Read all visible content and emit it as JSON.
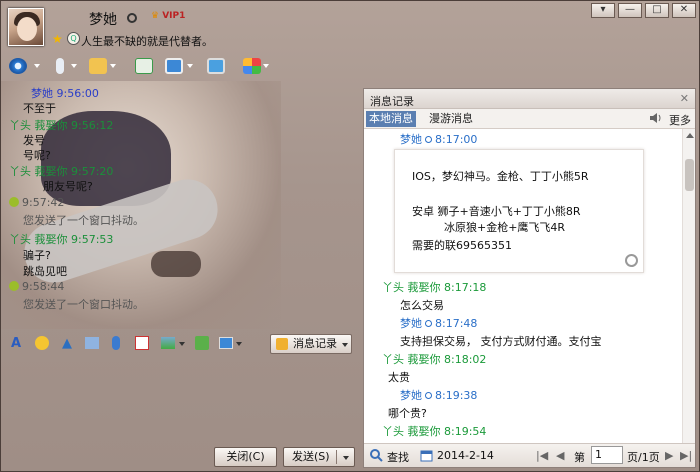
{
  "header": {
    "nickname": "梦她",
    "vip": "VIP1",
    "signature": "人生最不缺的就是代替者。"
  },
  "titlebar": {
    "menu": "▾",
    "minimize": "—",
    "maximize": "□",
    "close": "✕"
  },
  "chat": {
    "messages": [
      {
        "text": "梦她   9:56:00",
        "kind": "from-me"
      },
      {
        "text": "不至于",
        "kind": "plain"
      },
      {
        "text": "丫头   莪娶你   9:56:12",
        "kind": "from-other"
      },
      {
        "text": "发号",
        "kind": "plain"
      },
      {
        "text": "号呢?",
        "kind": "plain"
      },
      {
        "text": "丫头   莪娶你   9:57:20",
        "kind": "from-other"
      },
      {
        "text": "朋友号呢?",
        "kind": "plain"
      },
      {
        "text": "9:57:42",
        "kind": "sys"
      },
      {
        "text": "您发送了一个窗口抖动。",
        "kind": "sys"
      },
      {
        "text": "丫头   莪娶你   9:57:53",
        "kind": "from-other"
      },
      {
        "text": "骗子?",
        "kind": "plain"
      },
      {
        "text": "跳岛见吧",
        "kind": "plain"
      },
      {
        "text": "9:58:44",
        "kind": "sys"
      },
      {
        "text": "您发送了一个窗口抖动。",
        "kind": "sys"
      }
    ]
  },
  "format_bar": {
    "history_label": "消息记录"
  },
  "buttons": {
    "close": "关闭(C)",
    "send": "发送(S)"
  },
  "history": {
    "title": "消息记录",
    "tab_local": "本地消息",
    "tab_roam": "漫游消息",
    "more": "更多",
    "first_sender": "梦她",
    "first_time": "8:17:00",
    "image_lines": [
      "IOS，梦幻神马。金枪、丁丁小熊5R",
      "安卓  狮子+音速小飞+丁丁小熊8R",
      "冰原狼+金枪+鹰飞飞4R",
      "需要的联69565351"
    ],
    "entries": [
      {
        "sender": "丫头   莪娶你",
        "time": "8:17:18",
        "kind": "hl-other"
      },
      {
        "text": "怎么交易",
        "kind": "hl-text"
      },
      {
        "sender": "梦她",
        "time": "8:17:48",
        "kind": "hl-me"
      },
      {
        "text": "支持担保交易，   支付方式财付通。支付宝",
        "kind": "hl-text"
      },
      {
        "sender": "丫头   莪娶你",
        "time": "8:18:02",
        "kind": "hl-other"
      },
      {
        "text": "太贵",
        "kind": "hl-text"
      },
      {
        "sender": "梦她",
        "time": "8:19:38",
        "kind": "hl-me"
      },
      {
        "text": "哪个贵?",
        "kind": "hl-text"
      },
      {
        "sender": "丫头   莪娶你",
        "time": "8:19:54",
        "kind": "hl-other"
      }
    ],
    "footer": {
      "search": "查找",
      "date": "2014-2-14",
      "page_prefix": "第",
      "page_value": "1",
      "page_suffix": "页/1页"
    }
  },
  "colors": {
    "accent_tab": "#5b7fb1",
    "me": "#2a3ec8",
    "other": "#1b8f3a"
  }
}
